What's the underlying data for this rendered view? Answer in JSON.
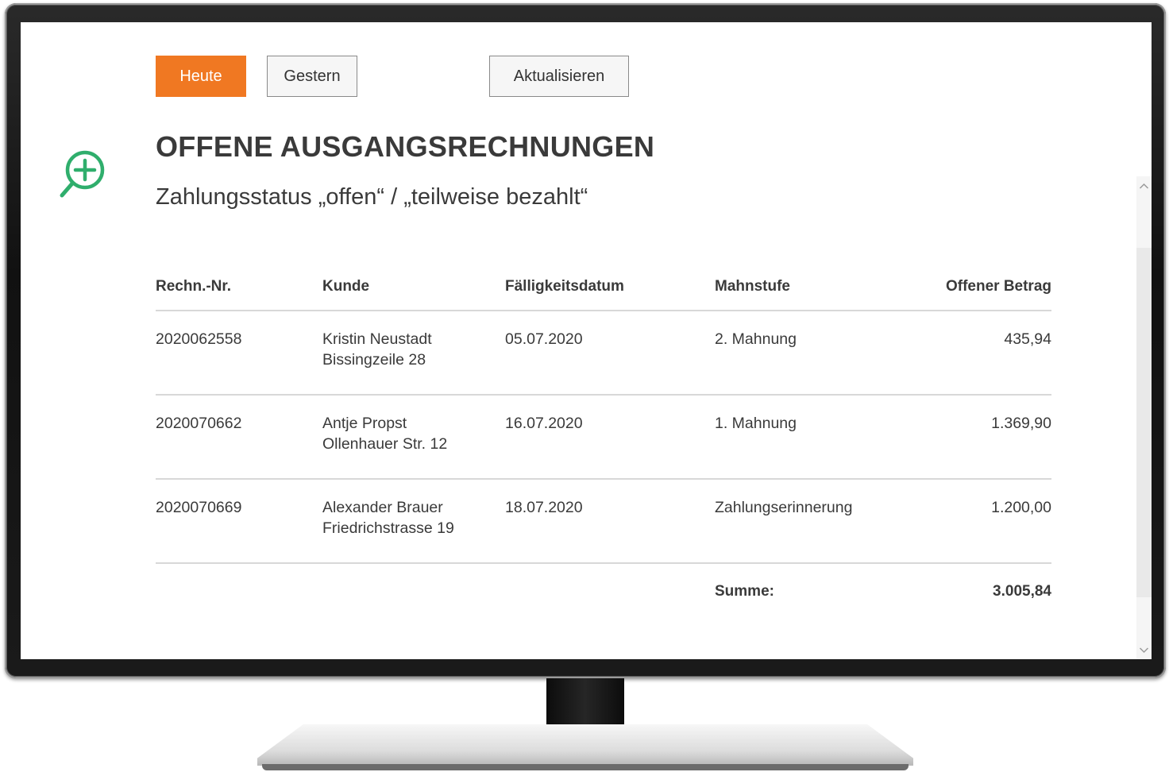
{
  "toolbar": {
    "today_label": "Heute",
    "yesterday_label": "Gestern",
    "refresh_label": "Aktualisieren"
  },
  "colors": {
    "accent": "#f07822",
    "icon_green": "#2fae6c",
    "text": "#3a3a3a"
  },
  "icons": {
    "zoom": "zoom-in-icon",
    "scroll_up": "chevron-up-icon",
    "scroll_down": "chevron-down-icon"
  },
  "heading": {
    "title": "OFFENE AUSGANGSRECHNUNGEN",
    "subtitle": "Zahlungsstatus „offen“ / „teilweise bezahlt“"
  },
  "table": {
    "columns": [
      "Rechn.-Nr.",
      "Kunde",
      "Fälligkeitsdatum",
      "Mahnstufe",
      "Offener Betrag"
    ],
    "rows": [
      {
        "number": "2020062558",
        "customer_name": "Kristin Neustadt",
        "customer_address": "Bissingzeile 28",
        "due_date": "05.07.2020",
        "dunning_level": "2. Mahnung",
        "amount": "435,94"
      },
      {
        "number": "2020070662",
        "customer_name": "Antje Propst",
        "customer_address": "Ollenhauer Str. 12",
        "due_date": "16.07.2020",
        "dunning_level": "1. Mahnung",
        "amount": "1.369,90"
      },
      {
        "number": "2020070669",
        "customer_name": "Alexander Brauer",
        "customer_address": "Friedrichstrasse 19",
        "due_date": "18.07.2020",
        "dunning_level": "Zahlungserinnerung",
        "amount": "1.200,00"
      }
    ],
    "sum_label": "Summe:",
    "sum_value": "3.005,84"
  }
}
